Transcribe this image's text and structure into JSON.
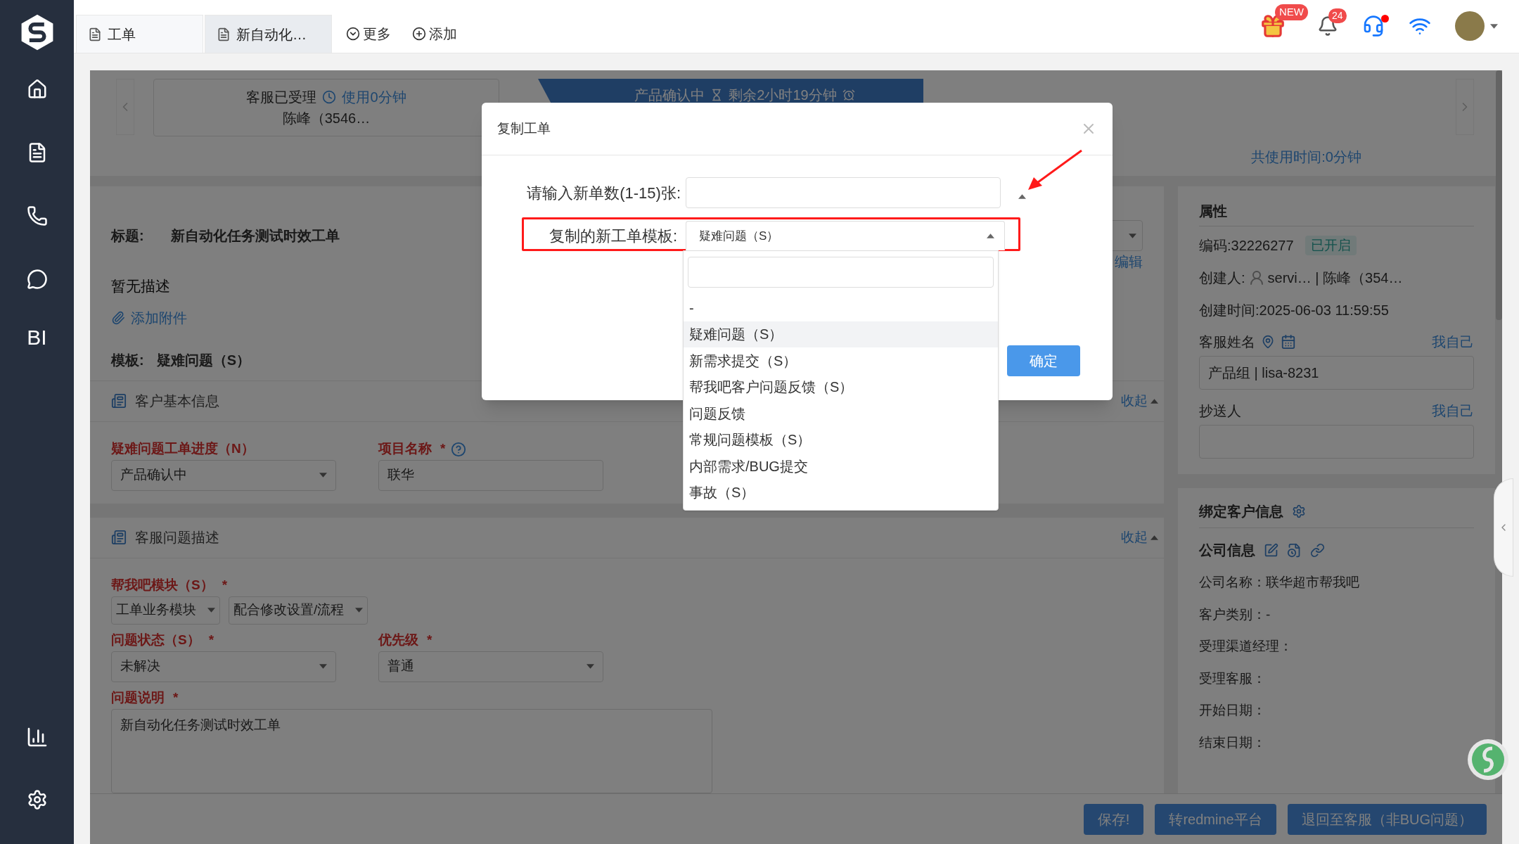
{
  "sidebar": {
    "text_item": "BI"
  },
  "tabs": [
    {
      "label": "工单",
      "selected": false
    },
    {
      "label": "新自动化…",
      "selected": true
    }
  ],
  "tab_actions": [
    "更多",
    "添加"
  ],
  "header": {
    "gift_badge": "NEW",
    "bell_badge": "24",
    "headset_dot": true
  },
  "progress": {
    "steps": [
      {
        "label": "客服已受理",
        "timer": "使用0分钟",
        "person": "陈峰（3546…",
        "current": false
      },
      {
        "label": "产品确认中",
        "timer": "剩余2小时19分钟",
        "current": true
      }
    ],
    "total_time": "共使用时间:0分钟"
  },
  "ticket": {
    "title_label": "标题:",
    "title": "新自动化任务测试时效工单",
    "description": "暂无描述",
    "attach": "添加附件",
    "template_label": "模板:",
    "template": "疑难问题（S）",
    "edit": "编辑"
  },
  "sections": [
    {
      "title": "客户基本信息",
      "collapse": "收起",
      "fields": [
        {
          "kind": "select",
          "label": "疑难问题工单进度（N）",
          "value": "产品确认中"
        },
        {
          "kind": "input",
          "label": "项目名称",
          "mark": "*",
          "help": true,
          "value": "联华"
        }
      ]
    },
    {
      "title": "客服问题描述",
      "collapse": "收起",
      "fields": [
        {
          "kind": "select_pair",
          "label": "帮我吧模块（S）",
          "mark": "*",
          "values": [
            "工单业务模块",
            "配合修改设置/流程"
          ]
        },
        {
          "kind": "select",
          "label": "问题状态（S）",
          "mark": "*",
          "value": "未解决"
        },
        {
          "kind": "select",
          "label": "优先级",
          "mark": "*",
          "value": "普通"
        },
        {
          "kind": "textarea",
          "label": "问题说明",
          "mark": "*",
          "value": "新自动化任务测试时效工单"
        }
      ]
    }
  ],
  "footer_buttons": [
    "保存!",
    "转redmine平台",
    "退回至客服（非BUG问题）"
  ],
  "properties": {
    "title": "属性",
    "code": "编码:32226277",
    "status": "已开启",
    "creator_label": "创建人:",
    "creator": "servi… | 陈峰（354…",
    "created": "创建时间:2025-06-03 11:59:55",
    "fields": [
      {
        "label": "客服姓名",
        "icons": true,
        "action": "我自己",
        "value": "产品组 | lisa-8231"
      },
      {
        "label": "抄送人",
        "icons": false,
        "action": "我自己"
      }
    ]
  },
  "customer": {
    "title": "绑定客户信息",
    "subtitle": "公司信息",
    "rows": [
      "公司名称：联华超市帮我吧",
      "客户类别：-",
      "受理渠道经理：",
      "受理客服：",
      "开始日期：",
      "结束日期："
    ]
  },
  "modal": {
    "title": "复制工单",
    "count_label": "请输入新单数(1-15)张:",
    "template_label": "复制的新工单模板:",
    "template_value": "疑难问题（S）",
    "confirm": "确定",
    "options": [
      {
        "label": "-",
        "selected": false
      },
      {
        "label": "疑难问题（S）",
        "selected": true
      },
      {
        "label": "新需求提交（S）",
        "selected": false
      },
      {
        "label": "帮我吧客户问题反馈（S）",
        "selected": false
      },
      {
        "label": "问题反馈",
        "selected": false
      },
      {
        "label": "常规问题模板（S）",
        "selected": false
      },
      {
        "label": "内部需求/BUG提交",
        "selected": false
      },
      {
        "label": "事故（S）",
        "selected": false
      }
    ]
  }
}
